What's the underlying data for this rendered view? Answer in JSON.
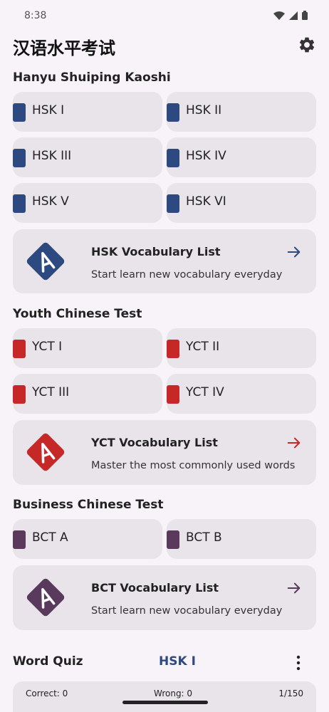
{
  "status": {
    "time": "8:38"
  },
  "app": {
    "title": "汉语水平考试"
  },
  "sections": {
    "hsk": {
      "title": "Hanyu Shuiping Kaoshi",
      "levels": [
        "HSK I",
        "HSK II",
        "HSK III",
        "HSK IV",
        "HSK V",
        "HSK VI"
      ],
      "vocab": {
        "title": "HSK Vocabulary List",
        "subtitle": "Start learn new vocabulary everyday"
      },
      "color": "#2c4a80"
    },
    "yct": {
      "title": "Youth Chinese Test",
      "levels": [
        "YCT I",
        "YCT II",
        "YCT III",
        "YCT IV"
      ],
      "vocab": {
        "title": "YCT Vocabulary List",
        "subtitle": "Master the most commonly used words"
      },
      "color": "#c62828"
    },
    "bct": {
      "title": "Business Chinese Test",
      "levels": [
        "BCT A",
        "BCT B"
      ],
      "vocab": {
        "title": "BCT Vocabulary List",
        "subtitle": "Start learn new vocabulary everyday"
      },
      "color": "#5a3a5c"
    }
  },
  "quiz": {
    "label": "Word Quiz",
    "level": "HSK I",
    "correct": "Correct: 0",
    "wrong": "Wrong: 0",
    "progress": "1/150"
  },
  "icons": {
    "settings": "gear-icon",
    "arrow": "arrow-right-icon",
    "more": "more-vert-icon",
    "logo": "letter-a-diamond-icon"
  }
}
